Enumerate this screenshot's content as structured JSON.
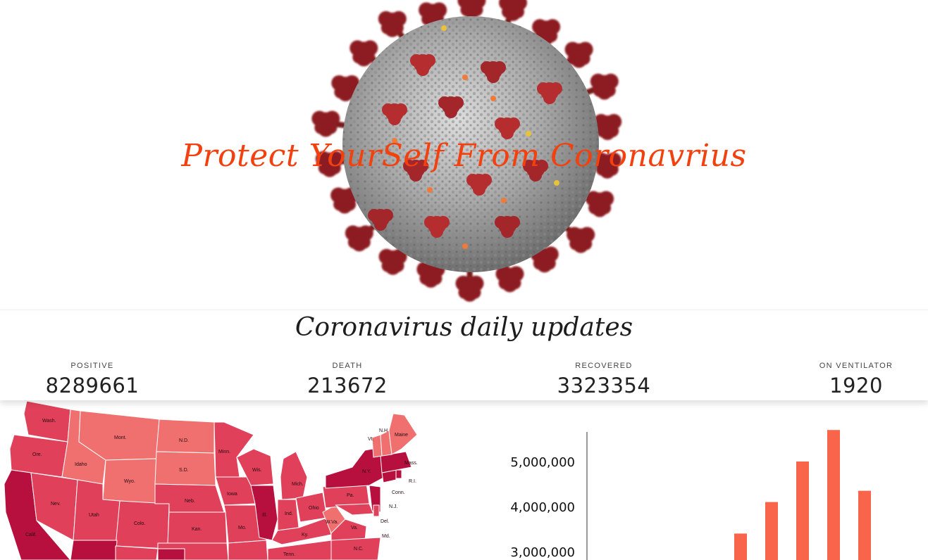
{
  "hero": {
    "title": "Protect YourSelf From Coronavrius"
  },
  "updates": {
    "title": "Coronavirus daily updates",
    "stats": [
      {
        "label": "POSITIVE",
        "value": "8289661"
      },
      {
        "label": "DEATH",
        "value": "213672"
      },
      {
        "label": "RECOVERED",
        "value": "3323354"
      },
      {
        "label": "ON VENTILATOR",
        "value": "1920"
      }
    ]
  },
  "map": {
    "state_labels": {
      "wa": "Wash.",
      "or": "Ore.",
      "ca": "Calif.",
      "nv": "Nev.",
      "id": "Idaho",
      "mt": "Mont.",
      "wy": "Wyo.",
      "ut": "Utah",
      "co": "Colo.",
      "nd": "N.D.",
      "sd": "S.D.",
      "ne": "Neb.",
      "ks": "Kan.",
      "mn": "Minn.",
      "ia": "Iowa",
      "mo": "Mo.",
      "wi": "Wis.",
      "il": "Ill.",
      "mi": "Mich.",
      "in": "Ind.",
      "oh": "Ohio",
      "ky": "Ky.",
      "tn": "Tenn.",
      "wv": "W.Va.",
      "va": "Va.",
      "nc": "N.C.",
      "pa": "Pa.",
      "ny": "N.Y.",
      "vt": "Vt.",
      "nh": "N.H.",
      "me": "Maine",
      "ma": "Mass.",
      "ri": "R.I.",
      "ct": "Conn.",
      "nj": "N.J.",
      "de": "Del.",
      "md": "Md."
    },
    "colors": {
      "light": "#f07070",
      "mid": "#e0405a",
      "dark": "#b8103e"
    }
  },
  "chart_data": {
    "type": "bar",
    "values": [
      3400000,
      4100000,
      5000000,
      5700000,
      4350000
    ],
    "y_ticks": [
      "5,000,000",
      "4,000,000",
      "3,000,000"
    ],
    "y_tick_values": [
      5000000,
      4000000,
      3000000
    ],
    "bar_color": "#f9654a"
  }
}
